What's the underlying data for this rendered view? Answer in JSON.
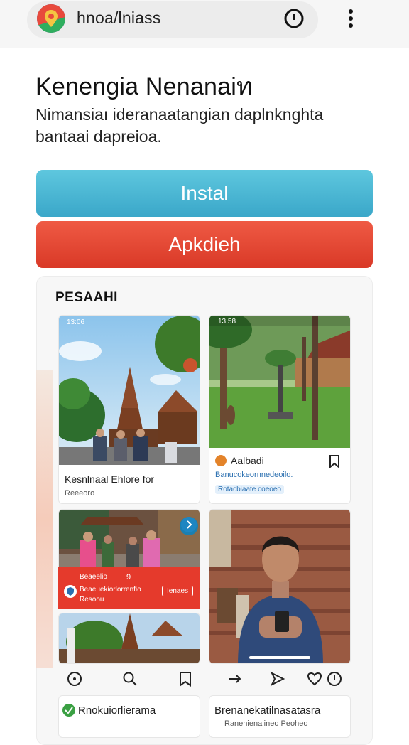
{
  "browser": {
    "url": "hnoa/lniass",
    "site_icon": "map-pin-icon",
    "tab_icon": "tab-switcher-icon",
    "menu_icon": "more-vertical-icon"
  },
  "hero": {
    "title": "Kenengia Nenanaiท",
    "description": "Nimansiaı ideranaatangian daplnknghta bantaai dapreioa."
  },
  "buttons": {
    "install": "Instal",
    "open": "Apkdieh"
  },
  "screenshots": {
    "section_title": "PESAAHI",
    "card1": {
      "status_time": "13:06",
      "caption": "Kesnlnaal Ehlore for",
      "sub": "Reeeoro"
    },
    "card2": {
      "status_time": "13:58",
      "title": "Aalbadi",
      "line1": "Banucokeornnedeoilo.",
      "chip": "Rotacbiaate coeoeo"
    },
    "card3": {
      "badge": "9",
      "strip_left": "Beaeelio",
      "strip_line": "Beaeuekiorlorrenfio",
      "strip_sub": "Resoou",
      "strip_button": "Ienaes"
    },
    "card5_icons": [
      "info-icon",
      "search-icon",
      "bookmark-icon"
    ],
    "card4_icons": [
      "arrow-right-icon",
      "send-icon",
      "heart-icon",
      "info-icon"
    ],
    "bottom_left": "Rnokuiorlierama",
    "bottom_right": "Brenanekatilnasatasra",
    "bottom_right_sub": "Ranenienalineo Peoheo"
  },
  "colors": {
    "install": "#4bb8d6",
    "open": "#e3442f",
    "accent_red": "#e53a2c"
  }
}
